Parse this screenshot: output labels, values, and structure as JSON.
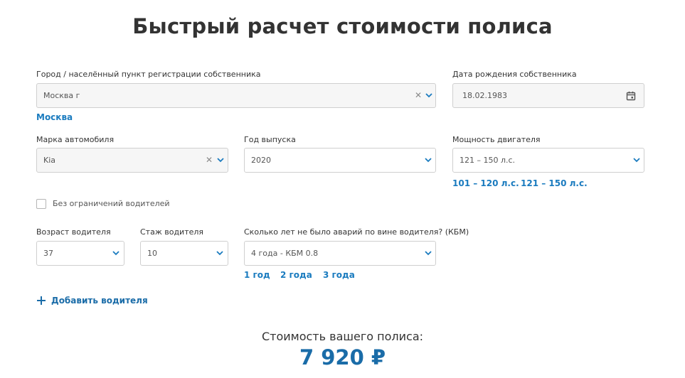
{
  "page": {
    "title": "Быстрый расчет стоимости полиса"
  },
  "owner_city": {
    "label": "Город / населённый пункт регистрации собственника",
    "value": "Москва г",
    "suggestion": "Москва"
  },
  "owner_birthdate": {
    "label": "Дата рождения собственника",
    "value": "18.02.1983"
  },
  "car_brand": {
    "label": "Марка автомобиля",
    "value": "Kia"
  },
  "car_year": {
    "label": "Год выпуска",
    "value": "2020"
  },
  "engine_power": {
    "label": "Мощность двигателя",
    "value": "121 – 150 л.с.",
    "suggestions": [
      "101 – 120 л.с.",
      "121 – 150 л.с."
    ]
  },
  "unlimited_drivers": {
    "label": "Без ограничений водителей",
    "checked": false
  },
  "driver_age": {
    "label": "Возраст водителя",
    "value": "37"
  },
  "driver_experience": {
    "label": "Стаж водителя",
    "value": "10"
  },
  "no_accident_years": {
    "label": "Сколько лет не было аварий по вине водителя? (КБМ)",
    "value": "4 года - КБМ 0.8",
    "suggestions": [
      "1 год",
      "2 года",
      "3 года"
    ]
  },
  "add_driver": {
    "label": "Добавить водителя",
    "icon": "plus-icon"
  },
  "price": {
    "caption": "Стоимость вашего полиса:",
    "value": "7 920 ₽"
  },
  "colors": {
    "accent": "#1a7bbf",
    "accent_dark": "#1a6ca8",
    "text": "#333333",
    "border": "#cfcfcf",
    "field_gray": "#f6f6f6"
  }
}
